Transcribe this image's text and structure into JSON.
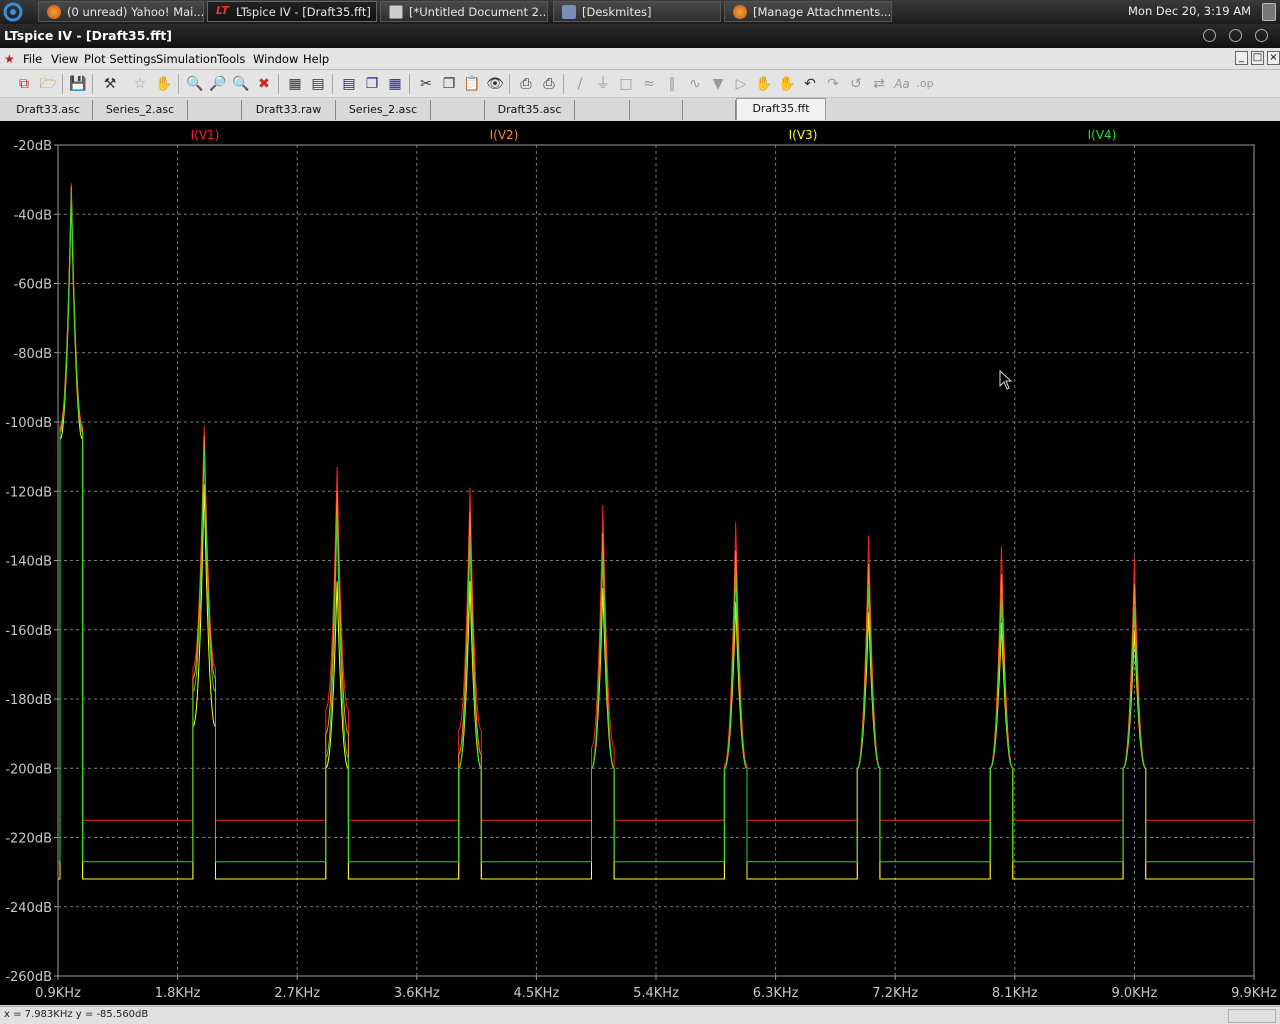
{
  "taskbar": {
    "tasks": [
      {
        "label": "(0 unread) Yahoo! Mai...",
        "icon": "firefox-icon"
      },
      {
        "label": "LTspice IV - [Draft35.fft]",
        "icon": "ltspice-icon"
      },
      {
        "label": "[*Untitled Document 2...",
        "icon": "text-editor-icon"
      },
      {
        "label": "[Deskmites]",
        "icon": "app-icon"
      },
      {
        "label": "[Manage Attachments...",
        "icon": "firefox-icon"
      }
    ],
    "clock": "Mon Dec 20,  3:19 AM"
  },
  "window": {
    "title": "LTspice IV - [Draft35.fft]"
  },
  "menu": {
    "items": [
      "File",
      "View",
      "Plot Settings",
      "Simulation",
      "Tools",
      "Window",
      "Help"
    ],
    "underline": [
      "F",
      "V",
      "P",
      "S",
      "T",
      "W",
      "H"
    ]
  },
  "tabs": [
    {
      "label": "Draft33.asc"
    },
    {
      "label": "Series_2.asc"
    },
    {
      "label": ""
    },
    {
      "label": "Draft33.raw"
    },
    {
      "label": "Series_2.asc"
    },
    {
      "label": ""
    },
    {
      "label": "Draft35.asc"
    },
    {
      "label": ""
    },
    {
      "label": ""
    },
    {
      "label": ""
    },
    {
      "label": "Draft35.fft",
      "active": true
    }
  ],
  "status": {
    "text": "x = 7.983KHz    y = -85.560dB"
  },
  "chart_data": {
    "type": "line",
    "title": "",
    "xlabel": "",
    "ylabel": "",
    "xlim": [
      0.9,
      9.9
    ],
    "ylim": [
      -260,
      -20
    ],
    "x_ticks": [
      "0.9KHz",
      "1.8KHz",
      "2.7KHz",
      "3.6KHz",
      "4.5KHz",
      "5.4KHz",
      "6.3KHz",
      "7.2KHz",
      "8.1KHz",
      "9.0KHz",
      "9.9KHz"
    ],
    "y_ticks": [
      "-20dB",
      "-40dB",
      "-60dB",
      "-80dB",
      "-100dB",
      "-120dB",
      "-140dB",
      "-160dB",
      "-180dB",
      "-200dB",
      "-220dB",
      "-240dB",
      "-260dB"
    ],
    "grid": true,
    "x_unit": "KHz",
    "peak_freqs_khz": [
      1.0,
      2.0,
      3.0,
      4.0,
      5.0,
      6.0,
      7.0,
      8.0,
      9.0
    ],
    "series": [
      {
        "name": "I(V1)",
        "color": "#ff2020",
        "floor_db": -215,
        "peaks_db": [
          -31,
          -101,
          -113,
          -119,
          -124,
          -129,
          -133,
          -136,
          -139
        ]
      },
      {
        "name": "I(V2)",
        "color": "#ff8c20",
        "floor_db": -232,
        "peaks_db": [
          -32,
          -104,
          -120,
          -126,
          -132,
          -137,
          -141,
          -144,
          -147
        ]
      },
      {
        "name": "I(V3)",
        "color": "#ffff20",
        "floor_db": -232,
        "peaks_db": [
          -35,
          -118,
          -146,
          -146,
          -148,
          -152,
          -155,
          -158,
          -160
        ]
      },
      {
        "name": "I(V4)",
        "color": "#20e020",
        "floor_db": -227,
        "peaks_db": [
          -33,
          -108,
          -127,
          -134,
          -139,
          -144,
          -148,
          -151,
          -154
        ]
      }
    ]
  }
}
